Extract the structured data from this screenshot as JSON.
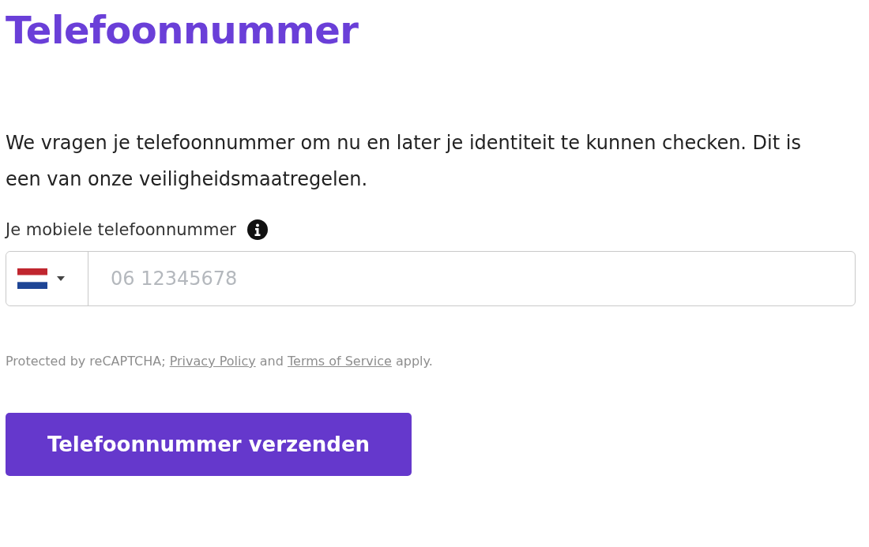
{
  "title": "Telefoonnummer",
  "intro": "We vragen je telefoonnummer om nu en later je identiteit te kunnen checken. Dit is een van onze veiligheidsmaatregelen.",
  "phone_field": {
    "label": "Je mobiele telefoonnummer",
    "placeholder": "06 12345678"
  },
  "recaptcha_notice": [
    {
      "kind": "text",
      "text": "Protected by reCAPTCHA; "
    },
    {
      "kind": "link",
      "text": "Privacy Policy"
    },
    {
      "kind": "text",
      "text": " and "
    },
    {
      "kind": "link",
      "text": "Terms of Service"
    },
    {
      "kind": "text",
      "text": " apply."
    }
  ],
  "submit_button": "Telefoonnummer verzenden"
}
